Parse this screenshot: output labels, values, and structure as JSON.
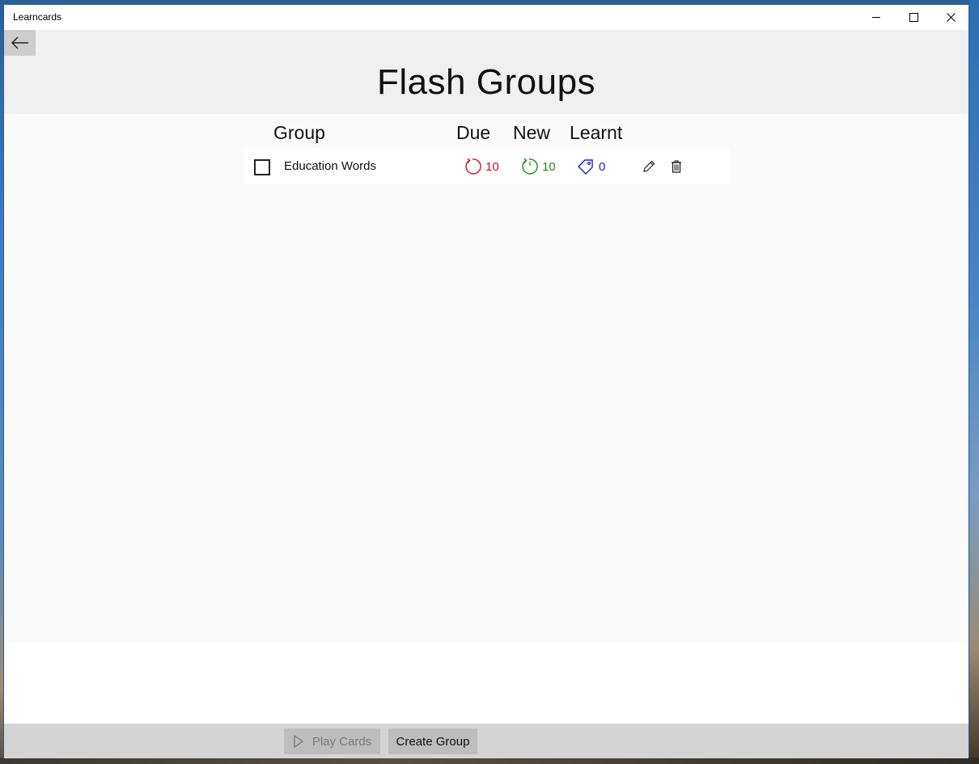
{
  "window": {
    "title": "Learncards"
  },
  "header": {
    "title": "Flash Groups"
  },
  "table": {
    "columns": [
      "Group",
      "Due",
      "New",
      "Learnt"
    ],
    "rows": [
      {
        "name": "Education Words",
        "due": "10",
        "new": "10",
        "learnt": "0",
        "checked": false
      }
    ]
  },
  "footer": {
    "play_label": "Play Cards",
    "create_label": "Create Group"
  },
  "colors": {
    "due": "#c4161c",
    "new": "#1b8a1b",
    "learnt": "#1a1ad6"
  },
  "icons": {
    "back": "arrow-left-icon",
    "due": "refresh-icon",
    "new": "refresh-one-icon",
    "learnt": "tag-icon",
    "edit": "pencil-icon",
    "delete": "trash-icon",
    "play": "play-icon"
  }
}
